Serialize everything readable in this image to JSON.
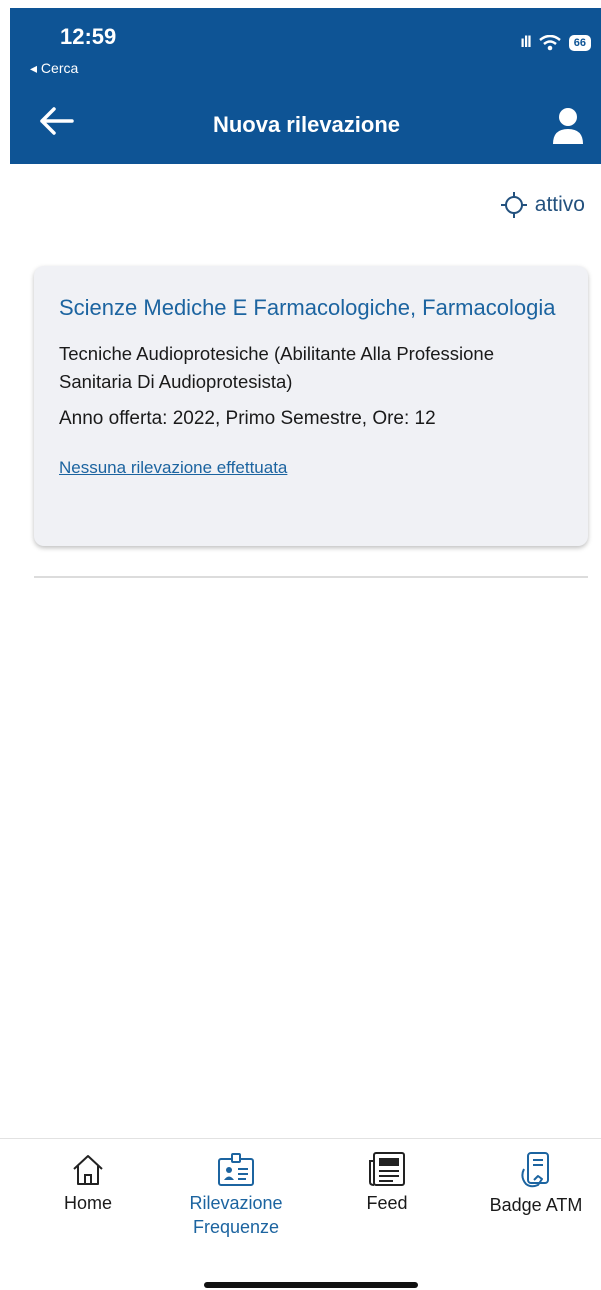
{
  "status_bar": {
    "time": "12:59",
    "back_app": "◂ Cerca",
    "battery": "66"
  },
  "header": {
    "title": "Nuova rilevazione"
  },
  "gps": {
    "status": "attivo"
  },
  "card": {
    "course_title": "Scienze Mediche E Farmacologiche, Farmacologia",
    "degree": "Tecniche Audioprotesiche (Abilitante Alla Professione Sanitaria Di Audioprotesista)",
    "offer": "Anno offerta: 2022, Primo Semestre, Ore: 12",
    "link": "Nessuna rilevazione effettuata"
  },
  "tabs": [
    {
      "label": "Home",
      "icon": "home-icon"
    },
    {
      "label": "Rilevazione Frequenze",
      "icon": "id-badge-icon",
      "active": true
    },
    {
      "label": "Feed",
      "icon": "newspaper-icon"
    },
    {
      "label": "Badge ATM",
      "icon": "phone-tap-icon"
    }
  ],
  "colors": {
    "header_bg": "#0e5495",
    "accent": "#1c64a0",
    "card_bg": "#f0f1f5"
  }
}
